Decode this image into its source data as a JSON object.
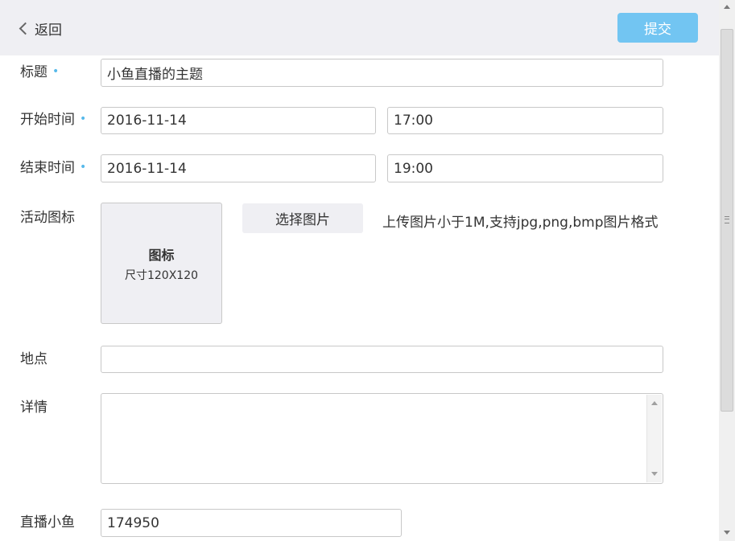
{
  "header": {
    "back_label": "返回",
    "submit_label": "提交"
  },
  "form": {
    "title": {
      "label": "标题",
      "required_mark": "•",
      "value": "小鱼直播的主题"
    },
    "start_time": {
      "label": "开始时间",
      "required_mark": "•",
      "date": "2016-11-14",
      "time": "17:00"
    },
    "end_time": {
      "label": "结束时间",
      "required_mark": "•",
      "date": "2016-11-14",
      "time": "19:00"
    },
    "activity_icon": {
      "label": "活动图标",
      "placeholder_title": "图标",
      "placeholder_size": "尺寸120X120",
      "choose_button": "选择图片",
      "hint": "上传图片小于1M,支持jpg,png,bmp图片格式"
    },
    "location": {
      "label": "地点",
      "value": ""
    },
    "details": {
      "label": "详情",
      "value": ""
    },
    "live_fish": {
      "label": "直播小鱼",
      "value": "174950"
    }
  },
  "colors": {
    "accent": "#72c5f2",
    "required_dot": "#57b9ea",
    "header_bg": "#efeff3"
  }
}
